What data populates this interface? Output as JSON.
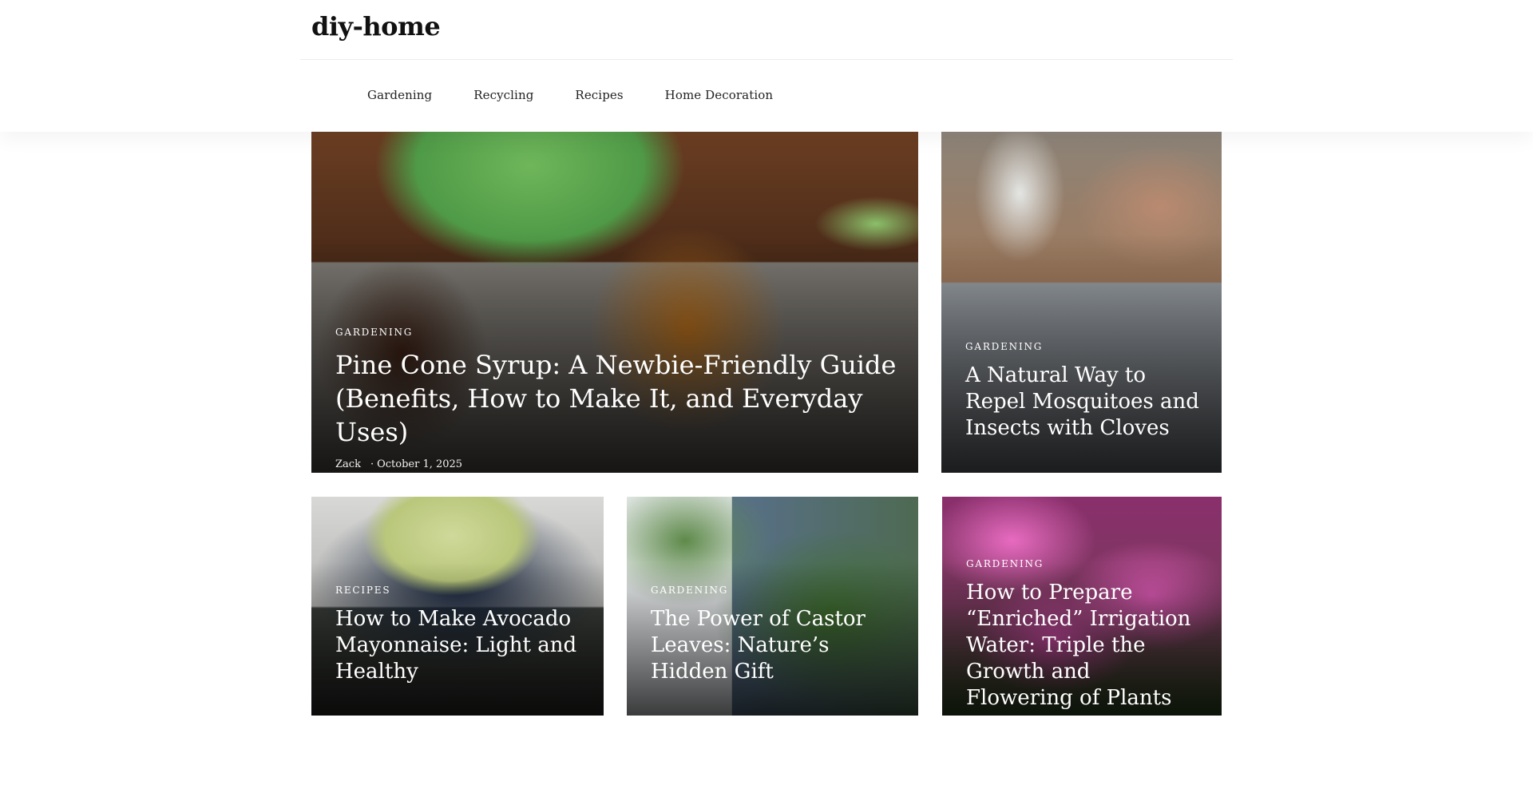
{
  "site": {
    "logo": "diy-home"
  },
  "nav": {
    "items": [
      {
        "label": "Gardening"
      },
      {
        "label": "Recycling"
      },
      {
        "label": "Recipes"
      },
      {
        "label": "Home Decoration"
      }
    ]
  },
  "posts": [
    {
      "category": "Gardening",
      "title": "Pine Cone Syrup: A Newbie-Friendly Guide (Benefits, How to Make It, and Everyday Uses)",
      "author": "Zack",
      "date": "October 1, 2025"
    },
    {
      "category": "Gardening",
      "title": "A Natural Way to Repel Mosquitoes and Insects with Cloves"
    },
    {
      "category": "Recipes",
      "title": "How to Make Avocado Mayonnaise: Light and Healthy"
    },
    {
      "category": "Gardening",
      "title": "The Power of Castor Leaves: Nature’s Hidden Gift"
    },
    {
      "category": "Gardening",
      "title": "How to Prepare “Enriched” Irrigation Water: Triple the Growth and Flowering of Plants"
    }
  ],
  "colors": {
    "background": "#ffffff",
    "text": "#111111",
    "overlay_text": "#ffffff"
  }
}
